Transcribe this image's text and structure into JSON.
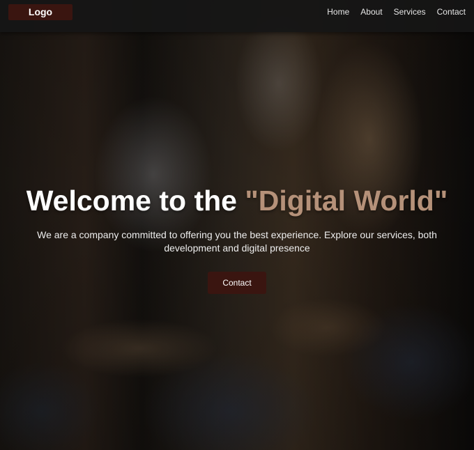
{
  "navbar": {
    "logo": "Logo",
    "links": [
      "Home",
      "About",
      "Services",
      "Contact"
    ]
  },
  "hero": {
    "title_main": "Welcome to the ",
    "title_highlight": "\"Digital World\"",
    "subtitle": "We are a company committed to offering you the best experience. Explore our services, both development and digital presence",
    "cta_label": "Contact"
  },
  "colors": {
    "navbar_bg": "#161616",
    "brand": "#3a1510",
    "highlight": "#b59179",
    "text": "#ffffff"
  }
}
